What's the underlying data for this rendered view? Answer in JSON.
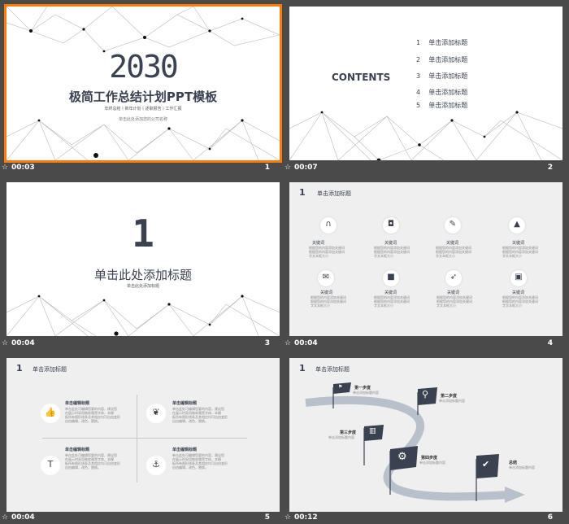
{
  "slides": [
    {
      "time": "00:03",
      "num": "1",
      "title_number": "2030",
      "title": "极简工作总结计划PPT模板",
      "subtitle": "年终总结丨新年计划丨述职报告丨工作汇报",
      "company": "单击此处添加您的公司名称"
    },
    {
      "time": "00:07",
      "num": "2",
      "heading": "CONTENTS",
      "items": [
        {
          "n": "1",
          "label": "单击添加标题"
        },
        {
          "n": "2",
          "label": "单击添加标题"
        },
        {
          "n": "3",
          "label": "单击添加标题"
        },
        {
          "n": "4",
          "label": "单击添加标题"
        },
        {
          "n": "5",
          "label": "单击添加标题"
        }
      ]
    },
    {
      "time": "00:04",
      "num": "3",
      "big_number": "1",
      "title": "单击此处添加标题",
      "subtitle": "单击此处添加标题"
    },
    {
      "time": "00:04",
      "num": "4",
      "section_number": "1",
      "section_title": "单击添加标题",
      "cells": [
        {
          "icon": "magnet-icon",
          "glyph": "∩",
          "title": "关键词",
          "text": "根据您的内容添加关键词\n根据您的内容添加关键词\n字文本框大小"
        },
        {
          "icon": "cup-icon",
          "glyph": "◘",
          "title": "关键词",
          "text": "根据您的内容添加关键词\n根据您的内容添加关键词\n字文本框大小"
        },
        {
          "icon": "brush-icon",
          "glyph": "✎",
          "title": "关键词",
          "text": "根据您的内容添加关键词\n根据您的内容添加关键词\n字文本框大小"
        },
        {
          "icon": "cone-icon",
          "glyph": "▲",
          "title": "关键词",
          "text": "根据您的内容添加关键词\n根据您的内容添加关键词\n字文本框大小"
        },
        {
          "icon": "chat-icon",
          "glyph": "✉",
          "title": "关键词",
          "text": "根据您的内容添加关键词\n根据您的内容添加关键词\n字文本框大小"
        },
        {
          "icon": "box-icon",
          "glyph": "■",
          "title": "关键词",
          "text": "根据您的内容添加关键词\n根据您的内容添加关键词\n字文本框大小"
        },
        {
          "icon": "rocket-icon",
          "glyph": "➶",
          "title": "关键词",
          "text": "根据您的内容添加关键词\n根据您的内容添加关键词\n字文本框大小"
        },
        {
          "icon": "briefcase-icon",
          "glyph": "▣",
          "title": "关键词",
          "text": "根据您的内容添加关键词\n根据您的内容添加关键词\n字文本框大小"
        }
      ]
    },
    {
      "time": "00:04",
      "num": "5",
      "section_number": "1",
      "section_title": "单击添加标题",
      "quadrants": [
        {
          "icon": "thumbs-up-icon",
          "glyph": "👍",
          "title": "单击编辑标题",
          "text": "单击此处可编辑您要的内容，建议您\n在展示时采用微软雅黑字体，本模\n板所有图形线条及其相应均可自由变形\n自由编辑，改色，替换。"
        },
        {
          "icon": "leaf-icon",
          "glyph": "❦",
          "title": "单击编辑标题",
          "text": "单击此处可编辑您要的内容，建议您\n在展示时采用微软雅黑字体，本模\n板所有图形线条及其相应均可自由变形\n自由编辑，改色，替换。"
        },
        {
          "icon": "shirt-icon",
          "glyph": "T",
          "title": "单击编辑标题",
          "text": "单击此处可编辑您要的内容，建议您\n在展示时采用微软雅黑字体，本模\n板所有图形线条及其相应均可自由变形\n自由编辑，改色，替换。"
        },
        {
          "icon": "anchor-icon",
          "glyph": "⚓",
          "title": "单击编辑标题",
          "text": "单击此处可编辑您要的内容，建议您\n在展示时采用微软雅黑字体，本模\n板所有图形线条及其相应均可自由变形\n自由编辑，改色，替换。"
        }
      ]
    },
    {
      "time": "00:12",
      "num": "6",
      "section_number": "1",
      "section_title": "单击添加标题",
      "steps": [
        {
          "title": "第一步度",
          "text": "单击添加标题内容"
        },
        {
          "title": "第二步度",
          "text": "单击添加标题内容"
        },
        {
          "title": "第三步度",
          "text": "单击添加标题内容"
        },
        {
          "title": "第四步度",
          "text": "单击添加标题内容"
        },
        {
          "title": "总结",
          "text": "单击添加标题内容"
        }
      ]
    }
  ],
  "colors": {
    "dark": "#3a4150",
    "selected": "#ff7a00",
    "background": "#4a4a4a"
  }
}
